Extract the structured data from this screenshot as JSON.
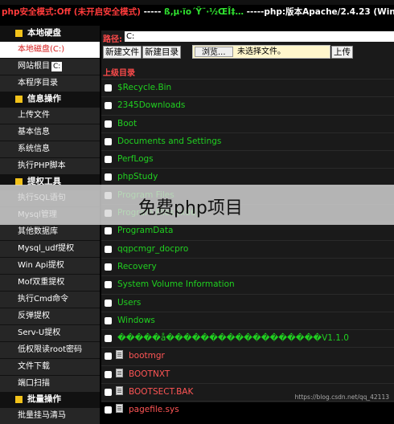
{
  "banner": {
    "safe_mode": "php安全模式:Off",
    "safe_mode_note": "(未开启安全模式)",
    "separator": "-----",
    "garbled": "ß‚µ·ïo´Ÿ¨·½ŒÎ‡…",
    "server_info": "-----php:版本Apache/2.4.23 (Win32) Op"
  },
  "sidebar": {
    "sections": [
      {
        "title": "本地硬盘",
        "items": [
          {
            "label": "本地磁盘(C:)",
            "active": true
          },
          {
            "label": "网站根目",
            "badge": "C:"
          },
          {
            "label": "本程序目录"
          }
        ]
      },
      {
        "title": "信息操作",
        "items": [
          {
            "label": "上传文件"
          },
          {
            "label": "基本信息"
          },
          {
            "label": "系统信息"
          },
          {
            "label": "执行PHP脚本"
          }
        ]
      },
      {
        "title": "提权工具",
        "items": [
          {
            "label": "执行SQL语句"
          },
          {
            "label": "Mysql管理"
          },
          {
            "label": "其他数据库"
          },
          {
            "label": "Mysql_udf提权"
          },
          {
            "label": "Win Api提权"
          },
          {
            "label": "Mof双重提权"
          },
          {
            "label": "执行Cmd命令"
          },
          {
            "label": "反弹提权"
          },
          {
            "label": "Serv-U提权"
          },
          {
            "label": "低权限读root密码"
          },
          {
            "label": "文件下载"
          },
          {
            "label": "端口扫描"
          }
        ]
      },
      {
        "title": "批量操作",
        "items": [
          {
            "label": "批量挂马清马"
          }
        ]
      }
    ]
  },
  "toolbar": {
    "path_label": "路径:",
    "path_value": "C:",
    "new_file": "新建文件",
    "new_dir": "新建目录",
    "browse": "浏览...",
    "no_file": "未选择文件。",
    "upload": "上传"
  },
  "parent_dir": "上级目录",
  "entries": [
    {
      "name": "$Recycle.Bin",
      "type": "dir"
    },
    {
      "name": "2345Downloads",
      "type": "dir"
    },
    {
      "name": "Boot",
      "type": "dir"
    },
    {
      "name": "Documents and Settings",
      "type": "dir"
    },
    {
      "name": "PerfLogs",
      "type": "dir"
    },
    {
      "name": "phpStudy",
      "type": "dir"
    },
    {
      "name": "Program Files",
      "type": "dir"
    },
    {
      "name": "Program Files (x86)",
      "type": "dir"
    },
    {
      "name": "ProgramData",
      "type": "dir"
    },
    {
      "name": "qqpcmgr_docpro",
      "type": "dir"
    },
    {
      "name": "Recovery",
      "type": "dir"
    },
    {
      "name": "System Volume Information",
      "type": "dir"
    },
    {
      "name": "Users",
      "type": "dir"
    },
    {
      "name": "Windows",
      "type": "dir"
    },
    {
      "name": "�����å������������������V1.1.0",
      "type": "dir"
    },
    {
      "name": "bootmgr",
      "type": "file"
    },
    {
      "name": "BOOTNXT",
      "type": "file"
    },
    {
      "name": "BOOTSECT.BAK",
      "type": "file"
    },
    {
      "name": "pagefile.sys",
      "type": "file"
    }
  ],
  "overlay_text": "免费php项目",
  "watermark": "https://blog.csdn.net/qq_42113"
}
